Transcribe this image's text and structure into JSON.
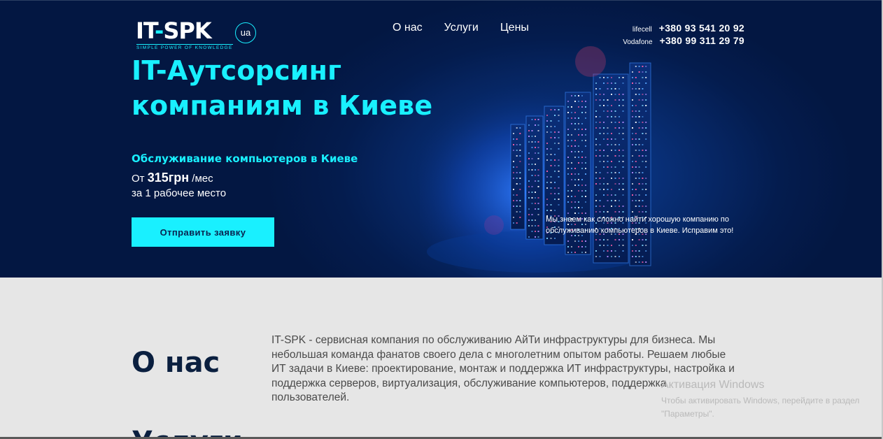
{
  "header": {
    "logo_text_part1": "IT",
    "logo_text_dash": "-",
    "logo_text_part2": "SPK",
    "logo_tagline": "SIMPLE POWER OF KNOWLEDGE",
    "language": "ua",
    "nav": [
      {
        "label": "О нас"
      },
      {
        "label": "Услуги"
      },
      {
        "label": "Цены"
      }
    ],
    "phones": [
      {
        "operator": "lifecell",
        "number": "+380 93 541 20 92"
      },
      {
        "operator": "Vodafone",
        "number": "+380 99 311 29 79"
      }
    ]
  },
  "hero": {
    "title_line1": "IT-Аутсорсинг",
    "title_line2": "компаниям в Киеве",
    "subtitle": "Обслуживание компьютеров в Киеве",
    "price_prefix": "От",
    "price_value": "315грн",
    "price_suffix": "/мес",
    "price_note": "за 1 рабочее место",
    "cta_label": "Отправить заявку",
    "note": "Мы знаем как сложно найти хорошую компанию по обслуживанию компьютеров в Киеве. Исправим это!"
  },
  "about": {
    "heading": "О нас",
    "text": "IT-SPK - сервисная компания по обслуживанию АйТи инфраструктуры для бизнеса. Мы небольшая команда фанатов своего дела с многолетним опытом работы. Решаем любые ИТ задачи в Киеве: проектирование, монтаж и поддержка ИТ инфраструктуры, настройка и поддержка серверов, виртуализация, обслуживание компьютеров, поддержка пользователей."
  },
  "services": {
    "heading": "Услуги"
  },
  "windows_activation": {
    "title": "Активация Windows",
    "message": "Чтобы активировать Windows, перейдите в раздел \"Параметры\"."
  },
  "colors": {
    "accent": "#19f0ff",
    "hero_bg": "#041c4e",
    "section_bg": "#e6e6e6",
    "heading_dark": "#0a1f3f"
  }
}
